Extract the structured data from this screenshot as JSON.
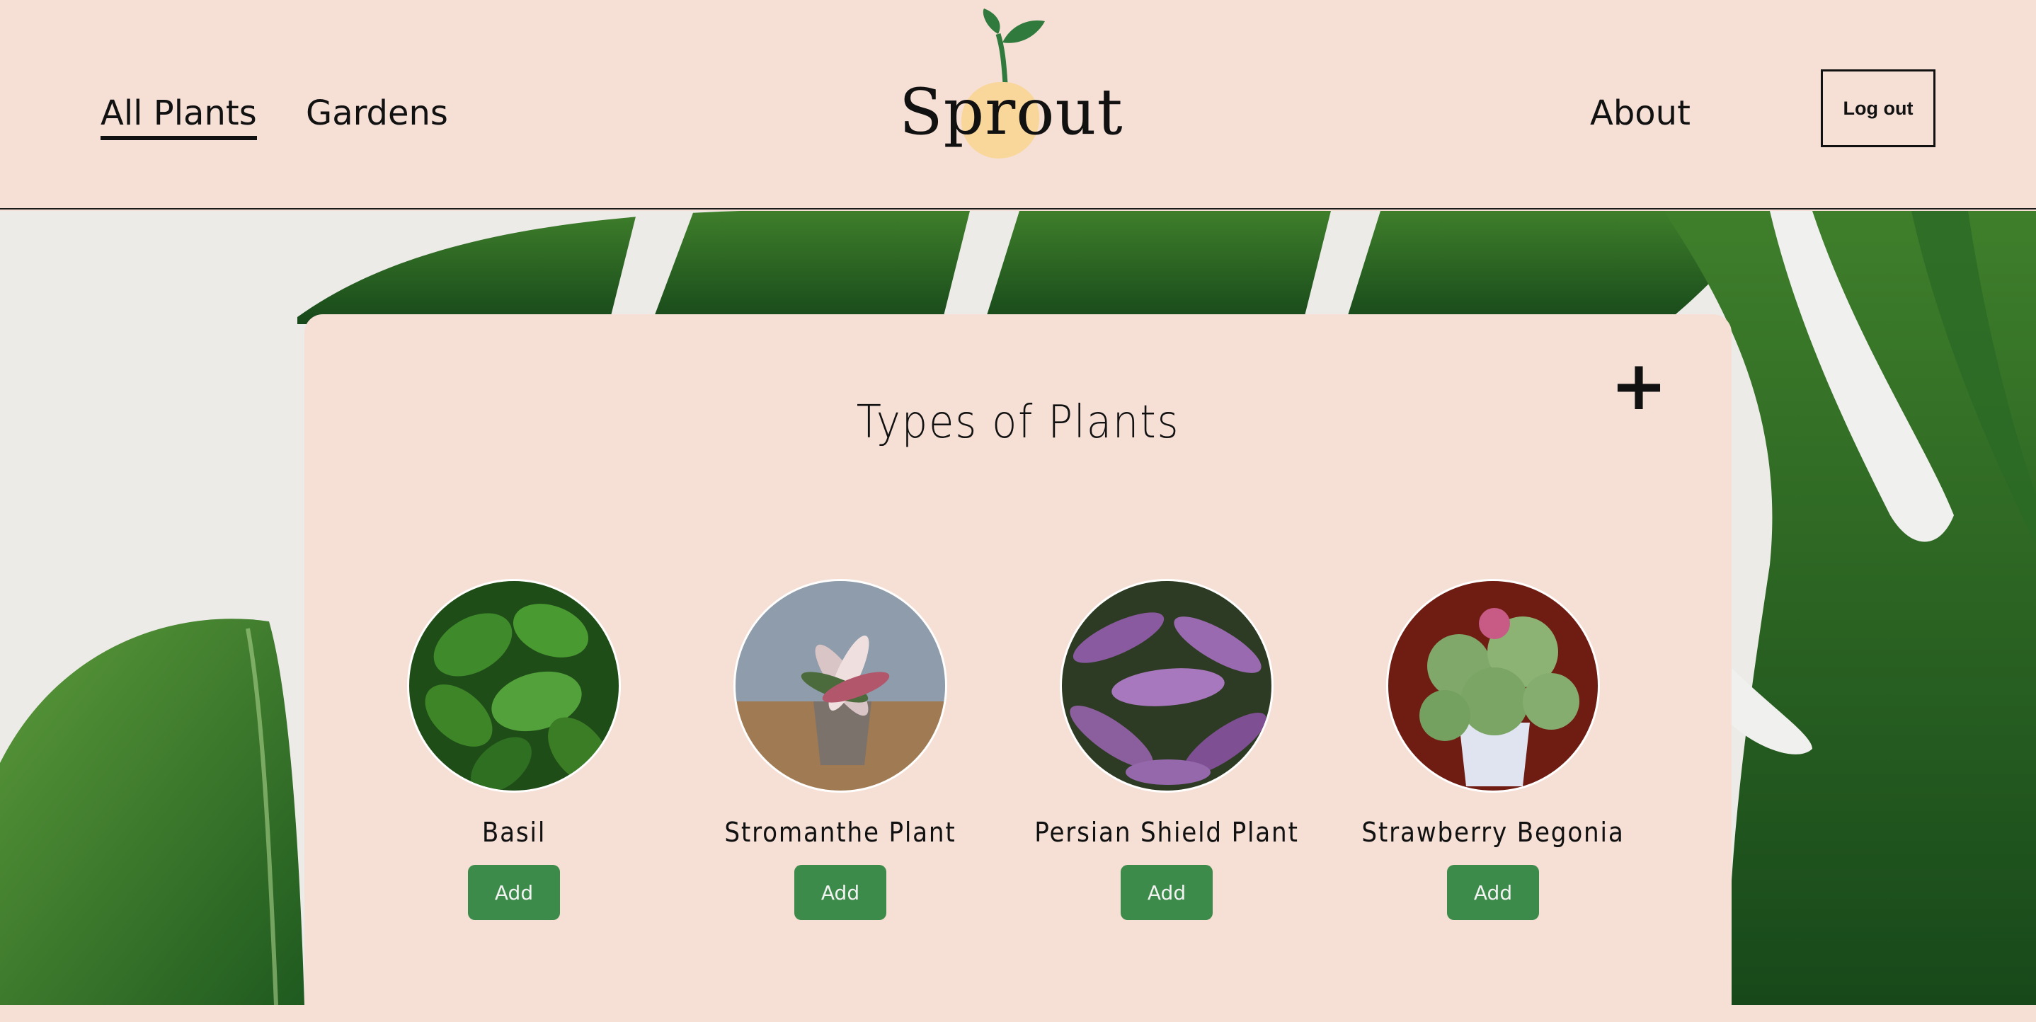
{
  "nav": {
    "all_plants": "All Plants",
    "gardens": "Gardens",
    "about": "About",
    "logout": "Log out"
  },
  "brand": {
    "name": "Sprout",
    "accent": "#3d8b4a",
    "blob": "#f9d79b"
  },
  "page": {
    "title": "Types of Plants",
    "add_icon": "plus-icon"
  },
  "plants": [
    {
      "name": "Basil",
      "button": "Add"
    },
    {
      "name": "Stromanthe Plant",
      "button": "Add"
    },
    {
      "name": "Persian Shield Plant",
      "button": "Add"
    },
    {
      "name": "Strawberry Begonia",
      "button": "Add"
    }
  ]
}
